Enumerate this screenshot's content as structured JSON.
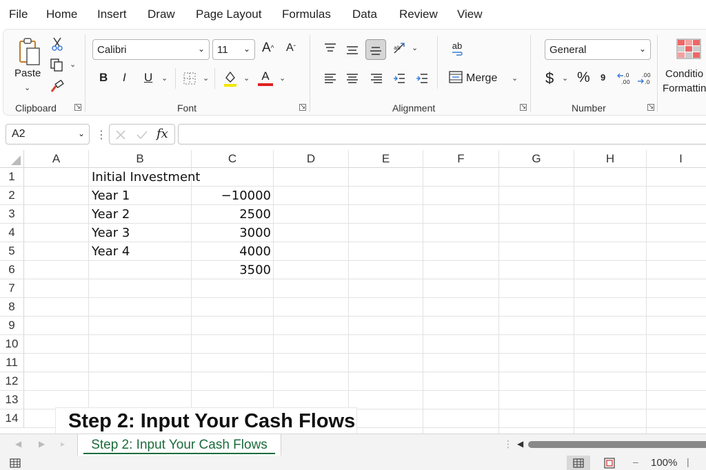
{
  "menu": [
    "File",
    "Home",
    "Insert",
    "Draw",
    "Page Layout",
    "Formulas",
    "Data",
    "Review",
    "View"
  ],
  "ribbon": {
    "clipboard": {
      "paste_label": "Paste",
      "group_label": "Clipboard"
    },
    "font": {
      "family": "Calibri",
      "size": "11",
      "bold": "B",
      "italic": "I",
      "underline": "U",
      "grow": "A",
      "shrink": "A",
      "font_color_letter": "A",
      "group_label": "Font"
    },
    "alignment": {
      "merge_label": "Merge",
      "wrap_icon": "ab",
      "group_label": "Alignment"
    },
    "number": {
      "format": "General",
      "currency": "$",
      "percent": "%",
      "comma": "9",
      "inc_decimal": ".0 .00",
      "dec_decimal": ".00 .0",
      "group_label": "Number"
    },
    "styles": {
      "conditional_line1": "Conditio",
      "conditional_line2": "Formattin"
    }
  },
  "formula_bar": {
    "name_box": "A2",
    "fx": "fx",
    "value": ""
  },
  "columns": [
    "A",
    "B",
    "C",
    "D",
    "E",
    "F",
    "G",
    "H",
    "I"
  ],
  "rows": [
    "1",
    "2",
    "3",
    "4",
    "5",
    "6",
    "7",
    "8",
    "9",
    "10",
    "11",
    "12",
    "13",
    "14"
  ],
  "cells": {
    "B1": "Initial Investment",
    "B2": "Year 1",
    "C2": "−10000",
    "B3": "Year 2",
    "C3": "2500",
    "B4": "Year 3",
    "C4": "3000",
    "B5": "Year 4",
    "C5": "4000",
    "C6": "3500"
  },
  "overlay_caption": "Step 2: Input Your Cash Flows",
  "sheet_tab": "Step 2: Input Your Cash Flows",
  "status": {
    "zoom": "100%",
    "minus": "–"
  },
  "colors": {
    "sheet_tab_green": "#1b6b3a",
    "font_color_red": "#e02020",
    "highlight_yellow": "#f2e600"
  }
}
